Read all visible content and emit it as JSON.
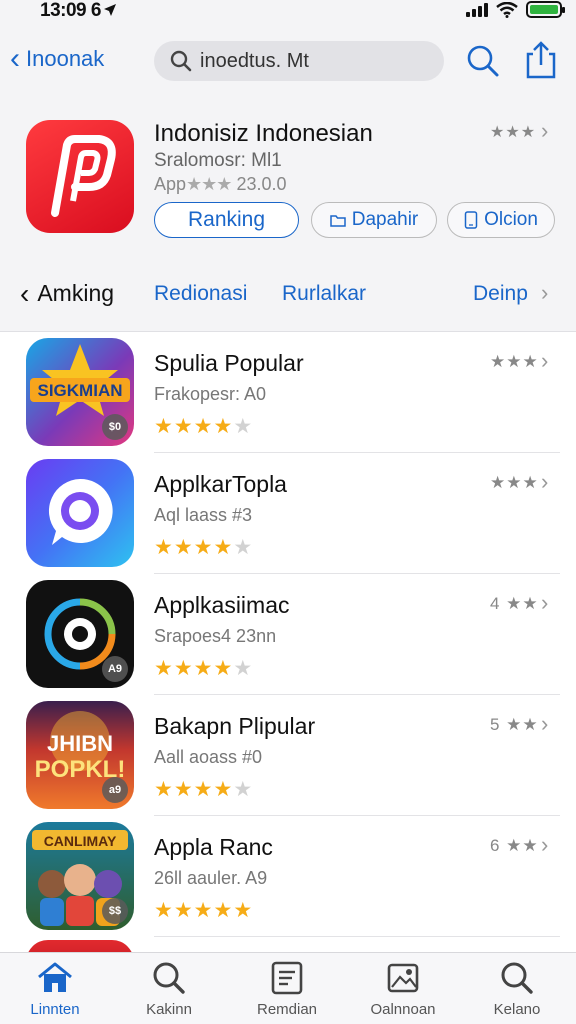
{
  "status_bar": {
    "time": "13:09 6"
  },
  "nav": {
    "back_label": "Inoonak",
    "search_value": "inoedtus. Mt"
  },
  "app": {
    "title": "Indonisiz Indonesian",
    "subtitle": "Sralomosr: Ml1",
    "meta_prefix": "App",
    "meta_stars": "★★★",
    "meta_value": "23.0.0",
    "rating": "★★★",
    "buttons": {
      "ranking": "Ranking",
      "dapahir": "Dapahir",
      "olcion": "Olcion"
    }
  },
  "segments": {
    "back_label": "Amking",
    "items": [
      "Redionasi",
      "Rurlalkar",
      "Deinp"
    ]
  },
  "list": [
    {
      "title": "Spulia Popular",
      "subtitle": "Frakopesr: A0",
      "rank": "★★★",
      "rating": 4,
      "badge": "$0",
      "icon": "star-badge-game-icon"
    },
    {
      "title": "ApplkarTopla",
      "subtitle": "Aql laass #3",
      "rank": "★★★",
      "rating": 4,
      "badge": "",
      "icon": "chat-bubble-icon"
    },
    {
      "title": "Applkasiimac",
      "subtitle": "Srapoes4 23nn",
      "rank": "4 ★★",
      "rating": 4,
      "badge": "A9",
      "icon": "sync-circle-icon"
    },
    {
      "title": "Bakapn Plipular",
      "subtitle": "Aall aoass #0",
      "rank": "5 ★★",
      "rating": 4,
      "badge": "a9",
      "icon": "poster-game-icon"
    },
    {
      "title": "Appla Ranc",
      "subtitle": "26ll aauler. A9",
      "rank": "6 ★★",
      "rating": 5,
      "badge": "$$",
      "icon": "characters-game-icon"
    }
  ],
  "tabs": [
    {
      "label": "Linnten",
      "icon": "home-icon",
      "active": true
    },
    {
      "label": "Kakinn",
      "icon": "search-icon",
      "active": false
    },
    {
      "label": "Remdian",
      "icon": "document-icon",
      "active": false
    },
    {
      "label": "Oalnnoan",
      "icon": "image-icon",
      "active": false
    },
    {
      "label": "Kelano",
      "icon": "search-icon",
      "active": false
    }
  ],
  "colors": {
    "accent": "#1a66c9",
    "star": "#f6ac17",
    "app_icon": "#e8202c"
  }
}
